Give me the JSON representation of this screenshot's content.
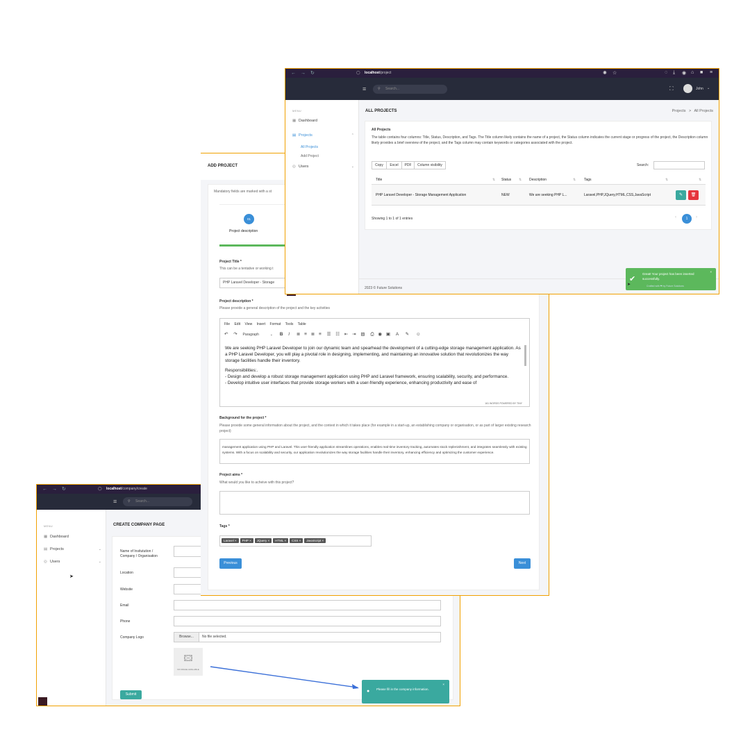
{
  "company": {
    "url_host": "localhost",
    "url_path": "/company/create",
    "search_placeholder": "Search...",
    "menu_label": "MENU",
    "sidebar": [
      {
        "label": "Dashboard",
        "icon": "dashboard-icon"
      },
      {
        "label": "Projects",
        "icon": "projects-icon"
      },
      {
        "label": "Users",
        "icon": "users-icon"
      }
    ],
    "page_title": "CREATE COMPANY PAGE",
    "fields": {
      "name_label": "Name of Insitutution / Company / Organisation",
      "location_label": "Location",
      "website_label": "Website",
      "email_label": "Email",
      "phone_label": "Phone",
      "logo_label": "Company Logo",
      "browse": "Browse...",
      "no_file": "No file selected.",
      "no_image": "NO IMAGE AVAILABLE"
    },
    "submit": "Submit",
    "toast": "Please fill in the company information."
  },
  "add_project": {
    "page_title": "ADD PROJECT",
    "mandatory_note": "Mandatory fields are marked with a st",
    "step_number": "01",
    "step_label": "Project description",
    "project_title_label": "Project Title *",
    "project_title_help": "This can be a tentative or working t",
    "project_title_value": "PHP Laravel Developer - Storage",
    "desc_label": "Project description *",
    "desc_help": "Please provide a general description of the project and the key activities",
    "editor_menu": [
      "File",
      "Edit",
      "View",
      "Insert",
      "Format",
      "Tools",
      "Table"
    ],
    "paragraph": "Paragraph",
    "editor_p1": "We are seeking PHP Laravel Developer to join our dynamic team and spearhead the development of a cutting-edge storage management application. As a PHP Laravel Developer, you will play a pivotal role in designing, implementing, and maintaining an innovative solution that revolutionizes the way storage facilities handle their inventory.",
    "editor_p2": "Responsibilities:.",
    "editor_p3": "- Design and develop a robust storage management application using PHP and Laravel framework, ensuring scalability, security, and performance.",
    "editor_p4": "- Develop intuitive user interfaces that provide storage workers with a user-friendly experience, enhancing productivity and ease of",
    "editor_footer": "161 WORDS  POWERED BY TINY",
    "bg_label": "Background for the project *",
    "bg_help": "Please provide some general information about the project, and the context in which it takes place (for example in a start-up, an establishing company or organisation, or as part of larger existing research project)",
    "bg_text": "management application using PHP and Laravel. This user-friendly application streamlines operations, enables real-time inventory tracking, automates stock replenishment, and integrates seamlessly with existing systems. With a focus on scalability and security, our application revolutionizes the way storage facilities handle their inventory, enhancing efficiency and optimizing the customer experience.",
    "aims_label": "Project aims *",
    "aims_help": "What would you like to acheive with this project?",
    "tags_label": "Tags *",
    "tags": [
      "Laravel",
      "PHP",
      "JQuery",
      "HTML",
      "CSS",
      "JavaScript"
    ],
    "previous": "Previous",
    "next": "Next"
  },
  "projects": {
    "url_host": "localhost",
    "url_path": "/project",
    "search_placeholder": "Search...",
    "user": "John",
    "menu_label": "MENU",
    "sidebar": [
      {
        "label": "Dashboard"
      },
      {
        "label": "Projects"
      },
      {
        "label": "Users"
      }
    ],
    "sub_items": [
      "All Projects",
      "Add Project"
    ],
    "page_title": "ALL PROJECTS",
    "breadcrumb": [
      "Projects",
      ">",
      "All Projects"
    ],
    "card_title": "All Projects",
    "card_desc": "The table contains four columns: Title, Status, Description, and Tags. The Title column likely contains the name of a project, the Status column indicates the current stage or progress of the project, the Description column likely provides a brief overview of the project, and the Tags column may contain keywords or categories associated with the project.",
    "buttons": [
      "Copy",
      "Excel",
      "PDF",
      "Column visibility"
    ],
    "search_label": "Search:",
    "columns": [
      "Title",
      "Status",
      "Description",
      "Tags"
    ],
    "rows": [
      {
        "title": "PHP Laravel Developer - Storage Management Application",
        "status": "NEW",
        "description": "We are seeking PHP L...",
        "tags": "Laravel,PHP,JQuery,HTML,CSS,JavaScript"
      }
    ],
    "showing": "Showing 1 to 1 of 1 entries",
    "page": "1",
    "footer": "2023 © Future Solutions",
    "footer_right": "Crafted with ❤ by Future Solutions",
    "toast": "Great! Your project has been inserted successfully."
  }
}
